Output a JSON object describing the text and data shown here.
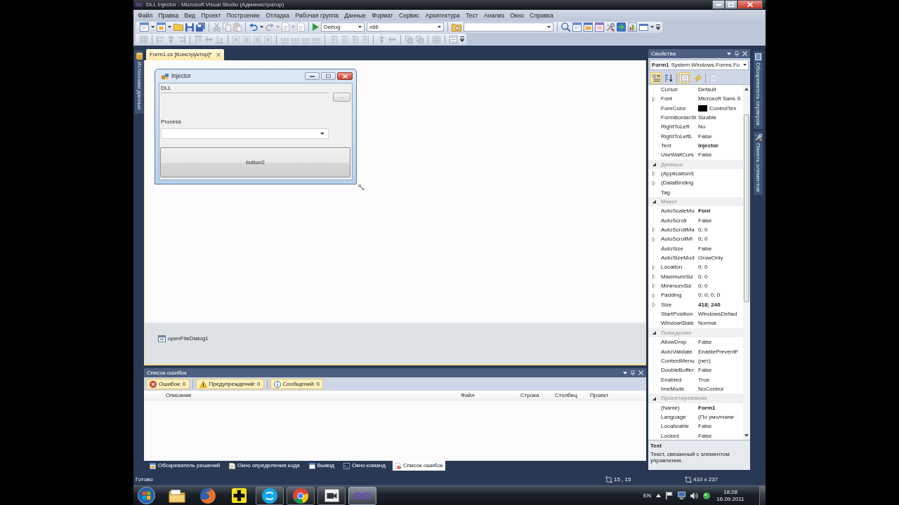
{
  "window": {
    "title": "DLL Injector - Microsoft Visual Studio (Администратор)"
  },
  "menu": [
    "Файл",
    "Правка",
    "Вид",
    "Проект",
    "Построение",
    "Отладка",
    "Рабочая группа",
    "Данные",
    "Формат",
    "Сервис",
    "Архитектура",
    "Тест",
    "Анализ",
    "Окно",
    "Справка"
  ],
  "toolbar": {
    "configuration": "Debug",
    "platform": "x86"
  },
  "left_dock_tabs": [
    {
      "label": "Источники данных"
    }
  ],
  "document_tabs": [
    {
      "label": "Form1.cs [Конструктор]*",
      "selected": true
    }
  ],
  "designer": {
    "form": {
      "title": "Injector",
      "dll_label": "DLL",
      "browse_button": "...",
      "process_label": "Process",
      "action_button": "button2"
    },
    "components": [
      {
        "label": "openFileDialog1"
      }
    ]
  },
  "properties": {
    "title": "Свойства",
    "object_name": "Form1",
    "object_type": "System.Windows.Forms.Fo",
    "toolbar": [
      {
        "kind": "categorized",
        "selected": true,
        "disabled": false
      },
      {
        "kind": "alphabetical",
        "selected": false,
        "disabled": false
      },
      {
        "kind": "properties",
        "selected": true,
        "disabled": false
      },
      {
        "kind": "events",
        "selected": false,
        "disabled": false
      },
      {
        "kind": "property_pages",
        "selected": false,
        "disabled": true
      }
    ],
    "rows": [
      {
        "kind": "property",
        "name": "Cursor",
        "value": "Default",
        "expandable": false,
        "modified": false
      },
      {
        "kind": "property",
        "name": "Font",
        "value": "Microsoft Sans S",
        "expandable": true,
        "modified": false
      },
      {
        "kind": "property",
        "name": "ForeColor",
        "value": "ControlTex",
        "color": "#000000",
        "expandable": false,
        "modified": false
      },
      {
        "kind": "property",
        "name": "FormBorderSt",
        "value": "Sizable",
        "expandable": false,
        "modified": false
      },
      {
        "kind": "property",
        "name": "RightToLeft",
        "value": "No",
        "expandable": false,
        "modified": false
      },
      {
        "kind": "property",
        "name": "RightToLeftL",
        "value": "False",
        "expandable": false,
        "modified": false
      },
      {
        "kind": "property",
        "name": "Text",
        "value": "Injector",
        "expandable": false,
        "modified": true
      },
      {
        "kind": "property",
        "name": "UseWaitCurs",
        "value": "False",
        "expandable": false,
        "modified": false
      },
      {
        "kind": "category",
        "name": "Данные",
        "expanded": true
      },
      {
        "kind": "property",
        "name": "(ApplicationS",
        "expandable": true
      },
      {
        "kind": "property",
        "name": "(DataBinding",
        "expandable": true
      },
      {
        "kind": "property",
        "name": "Tag",
        "expandable": false
      },
      {
        "kind": "category",
        "name": "Макет",
        "expanded": true
      },
      {
        "kind": "property",
        "name": "AutoScaleMo",
        "value": "Font",
        "expandable": false,
        "modified": true
      },
      {
        "kind": "property",
        "name": "AutoScroll",
        "value": "False",
        "expandable": false,
        "modified": false
      },
      {
        "kind": "property",
        "name": "AutoScrollMa",
        "value": "0; 0",
        "expandable": true,
        "modified": false
      },
      {
        "kind": "property",
        "name": "AutoScrollMi",
        "value": "0; 0",
        "expandable": true,
        "modified": false
      },
      {
        "kind": "property",
        "name": "AutoSize",
        "value": "False",
        "expandable": false,
        "modified": false
      },
      {
        "kind": "property",
        "name": "AutoSizeMod",
        "value": "GrowOnly",
        "expandable": false,
        "modified": false
      },
      {
        "kind": "property",
        "name": "Location",
        "value": "0; 0",
        "expandable": true,
        "modified": false
      },
      {
        "kind": "property",
        "name": "MaximumSiz",
        "value": "0; 0",
        "expandable": true,
        "modified": false
      },
      {
        "kind": "property",
        "name": "MinimumSiz",
        "value": "0; 0",
        "expandable": true,
        "modified": false
      },
      {
        "kind": "property",
        "name": "Padding",
        "value": "0; 0; 0; 0",
        "expandable": true,
        "modified": false
      },
      {
        "kind": "property",
        "name": "Size",
        "value": "418; 240",
        "expandable": true,
        "modified": true
      },
      {
        "kind": "property",
        "name": "StartPosition",
        "value": "WindowsDefaul",
        "expandable": false,
        "modified": false
      },
      {
        "kind": "property",
        "name": "WindowState",
        "value": "Normal",
        "expandable": false,
        "modified": false
      },
      {
        "kind": "category",
        "name": "Поведение",
        "expanded": true
      },
      {
        "kind": "property",
        "name": "AllowDrop",
        "value": "False",
        "expandable": false,
        "modified": false
      },
      {
        "kind": "property",
        "name": "AutoValidate",
        "value": "EnablePreventF",
        "expandable": false,
        "modified": false
      },
      {
        "kind": "property",
        "name": "ContextMenu",
        "value": "(нет)",
        "expandable": false,
        "modified": false
      },
      {
        "kind": "property",
        "name": "DoubleBuffer",
        "value": "False",
        "expandable": false,
        "modified": false
      },
      {
        "kind": "property",
        "name": "Enabled",
        "value": "True",
        "expandable": false,
        "modified": false
      },
      {
        "kind": "property",
        "name": "ImeMode",
        "value": "NoControl",
        "expandable": false,
        "modified": false
      },
      {
        "kind": "category",
        "name": "Проектирование",
        "expanded": true
      },
      {
        "kind": "property",
        "name": "(Name)",
        "value": "Form1",
        "expandable": false,
        "modified": true
      },
      {
        "kind": "property",
        "name": "Language",
        "value": "(По умолчани",
        "expandable": false,
        "modified": false
      },
      {
        "kind": "property",
        "name": "Localizable",
        "value": "False",
        "expandable": false,
        "modified": false
      },
      {
        "kind": "property",
        "name": "Locked",
        "value": "False",
        "expandable": false,
        "modified": false
      }
    ],
    "description": {
      "title": "Text",
      "text": "Текст, связанный с элементом управления."
    }
  },
  "right_dock_tabs": [
    {
      "kind": "server",
      "label": "Обозреватель серверов"
    },
    {
      "kind": "toolbox",
      "label": "Панель элементов"
    }
  ],
  "error_list": {
    "title": "Список ошибок",
    "filters": [
      {
        "kind": "error",
        "label": "Ошибок: 0",
        "selected": true
      },
      {
        "kind": "warning",
        "label": "Предупреждений: 0",
        "selected": true
      },
      {
        "kind": "message",
        "label": "Сообщений: 0",
        "selected": true
      }
    ],
    "columns": [
      "Описание",
      "Файл",
      "Строка",
      "Столбец",
      "Проект"
    ]
  },
  "bottom_tabs": [
    {
      "kind": "solution",
      "label": "Обозреватель решений",
      "selected": false
    },
    {
      "kind": "definition",
      "label": "Окно определения кода",
      "selected": false
    },
    {
      "kind": "output",
      "label": "Вывод",
      "selected": false
    },
    {
      "kind": "command",
      "label": "Окно команд",
      "selected": false
    },
    {
      "kind": "errors",
      "label": "Список ошибок",
      "selected": true
    }
  ],
  "status_bar": {
    "text": "Готово",
    "position": "15 , 15",
    "size": "410 x 237"
  },
  "taskbar": {
    "apps": [
      {
        "kind": "folder",
        "running": false,
        "selected": false
      },
      {
        "kind": "firefox",
        "running": false,
        "selected": false
      },
      {
        "kind": "plus",
        "running": false,
        "selected": false
      },
      {
        "kind": "skype",
        "running": true,
        "selected": false
      },
      {
        "kind": "chrome",
        "running": true,
        "selected": false
      },
      {
        "kind": "video",
        "running": true,
        "selected": false
      },
      {
        "kind": "vs",
        "running": true,
        "selected": true
      }
    ],
    "language": "EN",
    "time": "18:28",
    "date": "16.09.2011"
  }
}
